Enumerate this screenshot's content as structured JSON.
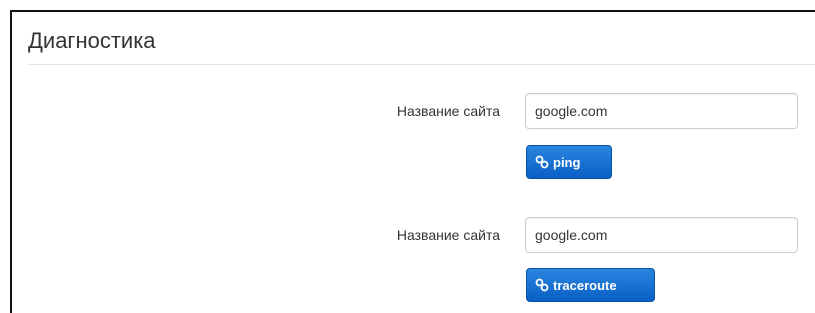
{
  "panel": {
    "title": "Диагностика"
  },
  "ping": {
    "label": "Название сайта",
    "value": "google.com",
    "button_label": "ping",
    "button_icon": "link-icon"
  },
  "traceroute": {
    "label": "Название сайта",
    "value": "google.com",
    "button_label": "traceroute",
    "button_icon": "link-icon"
  },
  "colors": {
    "button": "#0a5fc4",
    "button_text": "#ffffff",
    "border": "#111111"
  }
}
